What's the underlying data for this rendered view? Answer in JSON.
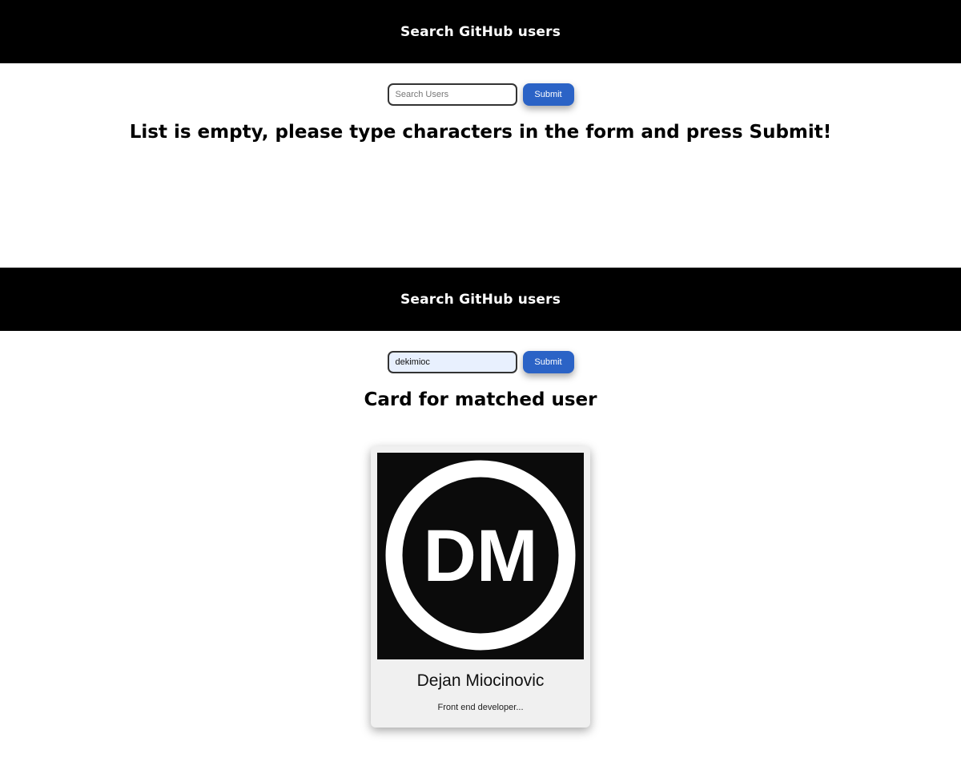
{
  "screens": {
    "empty": {
      "header_title": "Search GitHub users",
      "search": {
        "placeholder": "Search Users",
        "value": ""
      },
      "submit_label": "Submit",
      "message": "List is empty, please type characters in the form and press Submit!"
    },
    "result": {
      "header_title": "Search GitHub users",
      "search": {
        "placeholder": "Search Users",
        "value": "dekimioc"
      },
      "submit_label": "Submit",
      "message": "Card for matched user",
      "card": {
        "avatar_initials": "DM",
        "name": "Dejan Miocinovic",
        "bio": "Front end developer..."
      }
    }
  },
  "colors": {
    "header_bg": "#000000",
    "header_text": "#ffffff",
    "button_bg": "#2b63c6",
    "input_autofill_bg": "#e8f0fe",
    "card_bg": "#f0f0f0",
    "avatar_bg": "#0b0b0b"
  }
}
